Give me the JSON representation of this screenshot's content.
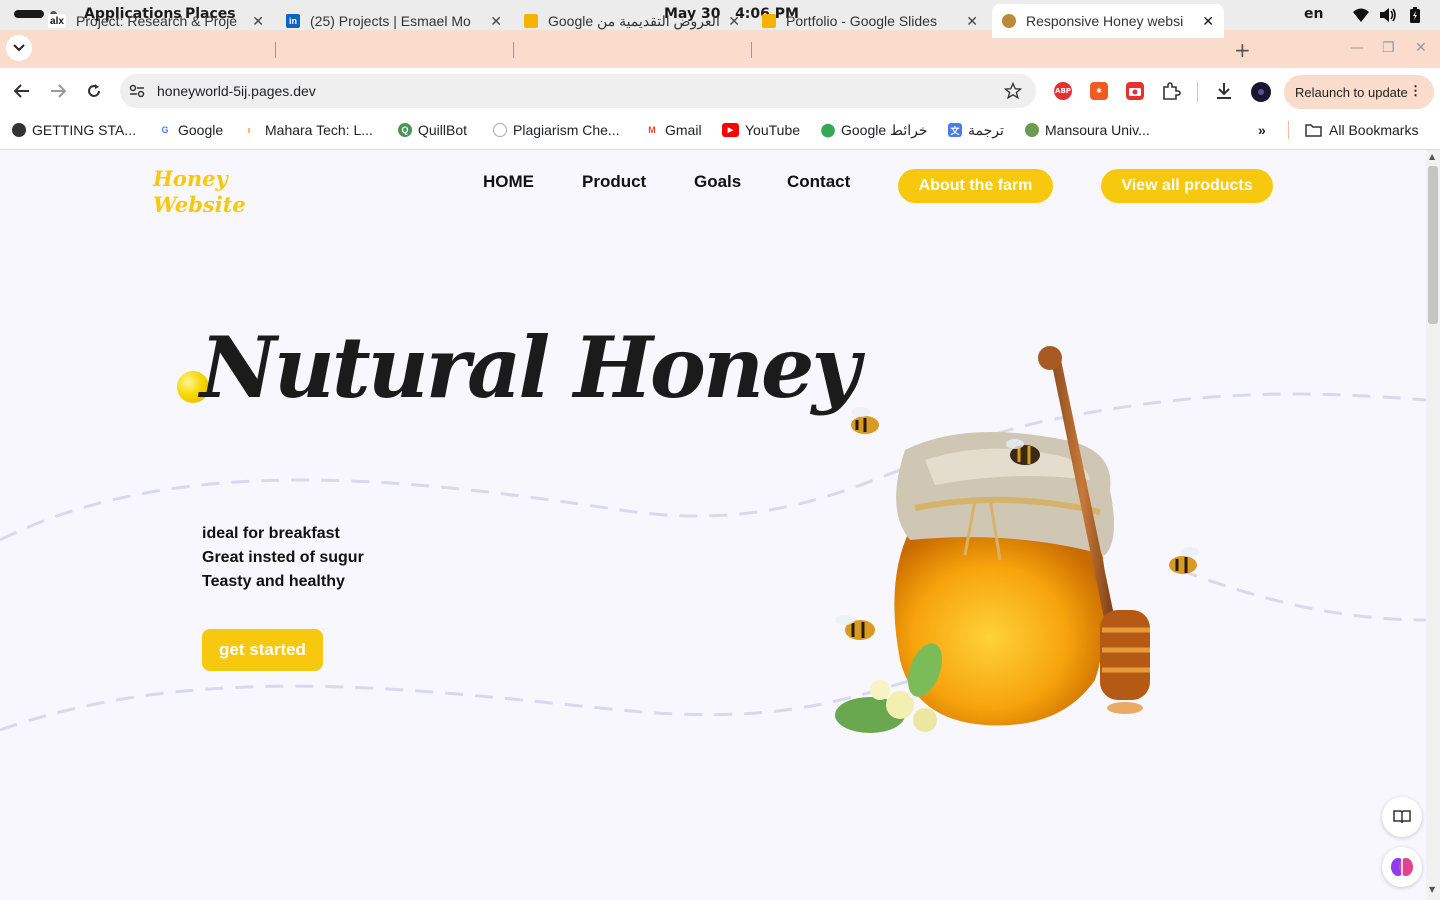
{
  "system_bar": {
    "applications": "Applications",
    "places": "Places",
    "date": "May 30",
    "time": "4:06 PM",
    "lang": "en"
  },
  "tabs": [
    {
      "title": "Project: Research & Proje",
      "favicon": "alx-icon"
    },
    {
      "title": "(25) Projects | Esmael Mo",
      "favicon": "linkedin-icon"
    },
    {
      "title": "العروض التقديمية من Google",
      "favicon": "google-slides-icon"
    },
    {
      "title": "Portfolio - Google Slides",
      "favicon": "google-slides-icon"
    },
    {
      "title": "Responsive Honey websi",
      "favicon": "honey-icon",
      "active": true
    }
  ],
  "address_bar": {
    "url": "honeyworld-5ij.pages.dev",
    "relaunch_label": "Relaunch to update"
  },
  "bookmarks": [
    {
      "label": "GETTING STA...",
      "icon": "globe-icon"
    },
    {
      "label": "Google",
      "icon": "google-icon"
    },
    {
      "label": "Mahara Tech: L...",
      "icon": "mahara-icon"
    },
    {
      "label": "QuillBot",
      "icon": "quillbot-icon"
    },
    {
      "label": "Plagiarism Che...",
      "icon": "plagiarism-icon"
    },
    {
      "label": "Gmail",
      "icon": "gmail-icon"
    },
    {
      "label": "YouTube",
      "icon": "youtube-icon"
    },
    {
      "label": "Google خرائط",
      "icon": "maps-icon"
    },
    {
      "label": "ترجمة",
      "icon": "translate-icon"
    },
    {
      "label": "Mansoura Univ...",
      "icon": "university-icon"
    }
  ],
  "all_bookmarks": "All Bookmarks",
  "site": {
    "logo_line1": "Honey",
    "logo_line2": "Website",
    "nav": [
      "HOME",
      "Product",
      "Goals",
      "Contact"
    ],
    "btn_about": "About the farm",
    "btn_products": "View all products",
    "hero_title": "Nutural Honey",
    "features": [
      "ideal for breakfast",
      "Great insted of sugur",
      "Teasty and healthy"
    ],
    "cta": "get started",
    "accent": "#f6c90e"
  }
}
